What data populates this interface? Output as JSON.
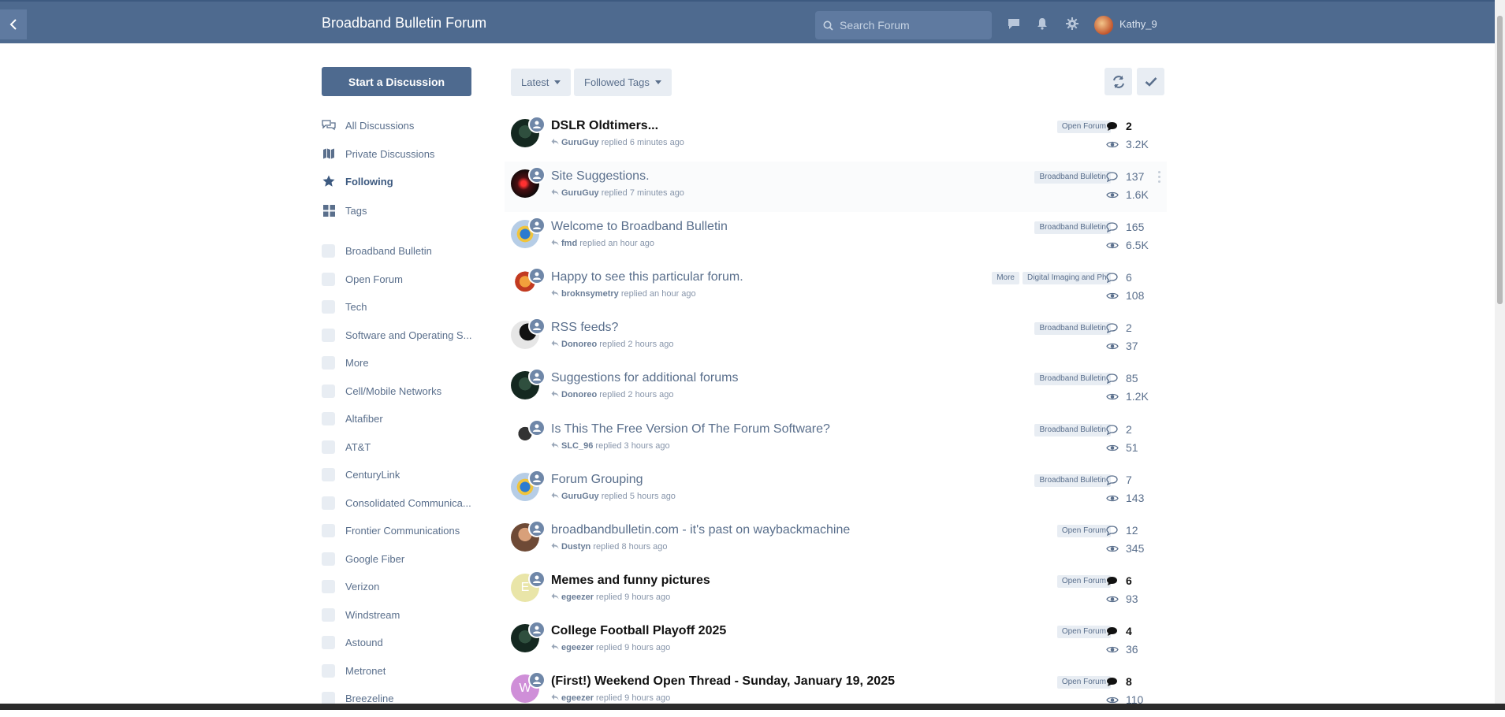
{
  "header": {
    "back_label": "",
    "site_title": "Broadband Bulletin Forum",
    "search_placeholder": "Search Forum",
    "username": "Kathy_9"
  },
  "sidebar": {
    "start_discussion": "Start a Discussion",
    "nav": [
      {
        "label": "All Discussions",
        "icon": "chat-bubbles-icon"
      },
      {
        "label": "Private Discussions",
        "icon": "map-icon"
      },
      {
        "label": "Following",
        "icon": "star-icon",
        "active": true
      },
      {
        "label": "Tags",
        "icon": "grid-icon"
      }
    ],
    "tags": [
      "Broadband Bulletin",
      "Open Forum",
      "Tech",
      "Software and Operating S...",
      "More",
      "Cell/Mobile Networks",
      "Altafiber",
      "AT&T",
      "CenturyLink",
      "Consolidated Communica...",
      "Frontier Communications",
      "Google Fiber",
      "Verizon",
      "Windstream",
      "Astound",
      "Metronet",
      "Breezeline"
    ]
  },
  "toolbar": {
    "sort_label": "Latest",
    "filter_label": "Followed Tags"
  },
  "colors": {
    "header_bg": "#4e6a8f",
    "accent": "#4e6a8f",
    "tag_bg": "#e8edf3",
    "muted_text": "#5a6f8c"
  },
  "discussions": [
    {
      "title": "DSLR Oldtimers...",
      "user": "GuruGuy",
      "action": "replied",
      "time": "6 minutes ago",
      "tags": [
        "Open Forum"
      ],
      "replies": "2",
      "views": "3.2K",
      "unread": true
    },
    {
      "title": "Site Suggestions.",
      "user": "GuruGuy",
      "action": "replied",
      "time": "7 minutes ago",
      "tags": [
        "Broadband Bulletin"
      ],
      "replies": "137",
      "views": "1.6K",
      "unread": false
    },
    {
      "title": "Welcome to Broadband Bulletin",
      "user": "fmd",
      "action": "replied",
      "time": "an hour ago",
      "tags": [
        "Broadband Bulletin"
      ],
      "replies": "165",
      "views": "6.5K",
      "unread": false
    },
    {
      "title": "Happy to see this particular forum.",
      "user": "broknsymetry",
      "action": "replied",
      "time": "an hour ago",
      "tags": [
        "More",
        "Digital Imaging and Ph"
      ],
      "replies": "6",
      "views": "108",
      "unread": false
    },
    {
      "title": "RSS feeds?",
      "user": "Donoreo",
      "action": "replied",
      "time": "2 hours ago",
      "tags": [
        "Broadband Bulletin"
      ],
      "replies": "2",
      "views": "37",
      "unread": false
    },
    {
      "title": "Suggestions for additional forums",
      "user": "Donoreo",
      "action": "replied",
      "time": "2 hours ago",
      "tags": [
        "Broadband Bulletin"
      ],
      "replies": "85",
      "views": "1.2K",
      "unread": false
    },
    {
      "title": "Is This The Free Version Of The Forum Software?",
      "user": "SLC_96",
      "action": "replied",
      "time": "3 hours ago",
      "tags": [
        "Broadband Bulletin"
      ],
      "replies": "2",
      "views": "51",
      "unread": false
    },
    {
      "title": "Forum Grouping",
      "user": "GuruGuy",
      "action": "replied",
      "time": "5 hours ago",
      "tags": [
        "Broadband Bulletin"
      ],
      "replies": "7",
      "views": "143",
      "unread": false
    },
    {
      "title": "broadbandbulletin.com - it's past on waybackmachine",
      "user": "Dustyn",
      "action": "replied",
      "time": "8 hours ago",
      "tags": [
        "Open Forum"
      ],
      "replies": "12",
      "views": "345",
      "unread": false
    },
    {
      "title": "Memes and funny pictures",
      "user": "egeezer",
      "action": "replied",
      "time": "9 hours ago",
      "tags": [
        "Open Forum"
      ],
      "replies": "6",
      "views": "93",
      "unread": true,
      "avatar_letter": "E"
    },
    {
      "title": "College Football Playoff 2025",
      "user": "egeezer",
      "action": "replied",
      "time": "9 hours ago",
      "tags": [
        "Open Forum"
      ],
      "replies": "4",
      "views": "36",
      "unread": true
    },
    {
      "title": "(First!) Weekend Open Thread - Sunday, January 19, 2025",
      "user": "egeezer",
      "action": "replied",
      "time": "9 hours ago",
      "tags": [
        "Open Forum"
      ],
      "replies": "8",
      "views": "110",
      "unread": true,
      "avatar_letter": "W"
    }
  ]
}
